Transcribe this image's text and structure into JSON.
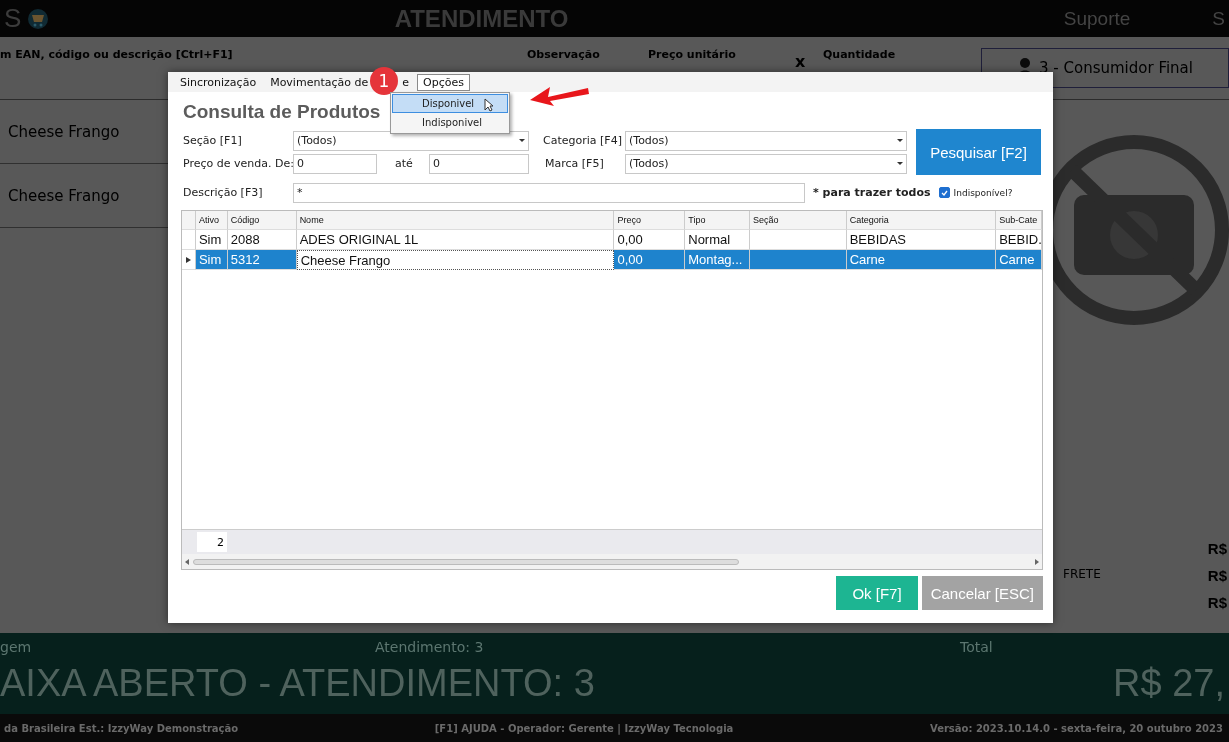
{
  "app": {
    "logo": "S",
    "title": "ATENDIMENTO",
    "nav": [
      "Suporte",
      "S"
    ]
  },
  "entry_bar": {
    "search_label": "m EAN, código ou descrição [Ctrl+F1]",
    "observation_label": "Observação",
    "unit_price_label": "Preço unitário",
    "multiply": "x",
    "quantity_label": "Quantidade",
    "customer": "3 - Consumidor Final"
  },
  "items": [
    {
      "name": "Cheese Frango"
    },
    {
      "name": "Cheese Frango"
    }
  ],
  "totals": [
    {
      "value": "R$"
    },
    {
      "label": "FRETE",
      "value": "R$"
    },
    {
      "value": "R$"
    }
  ],
  "status_panel": {
    "message_label": "gem",
    "attendance_label": "Atendimento: 3",
    "total_label": "Total",
    "message": "AIXA ABERTO - ATENDIMENTO: 3",
    "total": "R$ 27,"
  },
  "footer": {
    "left": "da Brasileira  Est.: IzzyWay Demonstração",
    "center": "[F1] AJUDA - Operador: Gerente | IzzyWay Tecnologia",
    "right": "Versão: 2023.10.14.0 - sexta-feira, 20 outubro 2023"
  },
  "dialog": {
    "menu": [
      {
        "label": "Sincronização",
        "open": false
      },
      {
        "label": "Movimentação de",
        "label_end": "e",
        "badge": "1",
        "open": false
      },
      {
        "label": "Opções",
        "open": true
      }
    ],
    "dropdown": [
      {
        "label": "Disponivel",
        "selected": true
      },
      {
        "label": "Indisponivel",
        "selected": false
      }
    ],
    "title": "Consulta de Produtos",
    "section": {
      "label": "Seção [F1]",
      "value": "(Todos)"
    },
    "category": {
      "label": "Categoria [F4]",
      "value": "(Todos)"
    },
    "price_from": {
      "label": "Preço de venda. De:",
      "value": "0"
    },
    "price_to": {
      "label": "até",
      "value": "0"
    },
    "brand": {
      "label": "Marca [F5]",
      "value": "(Todos)"
    },
    "description": {
      "label": "Descrição [F3]",
      "value": "*"
    },
    "hint": "* para trazer todos",
    "unavailable": {
      "label": "Indisponível?",
      "checked": true
    },
    "search_button": "Pesquisar [F2]",
    "table": {
      "columns": [
        "Ativo",
        "Código",
        "Nome",
        "Preço",
        "Tipo",
        "Seção",
        "Categoria",
        "Sub-Cate"
      ],
      "rows": [
        {
          "selected": false,
          "cells": [
            "Sim",
            "2088",
            " ADES ORIGINAL 1L",
            "0,00",
            "Normal",
            "",
            "BEBIDAS",
            "BEBID."
          ]
        },
        {
          "selected": true,
          "cells": [
            "Sim",
            "5312",
            "Cheese Frango",
            "0,00",
            "Montag...",
            "",
            "Carne",
            "Carne"
          ]
        }
      ],
      "row_count": "2"
    },
    "ok_button": "Ok [F7]",
    "cancel_button": "Cancelar [ESC]"
  }
}
